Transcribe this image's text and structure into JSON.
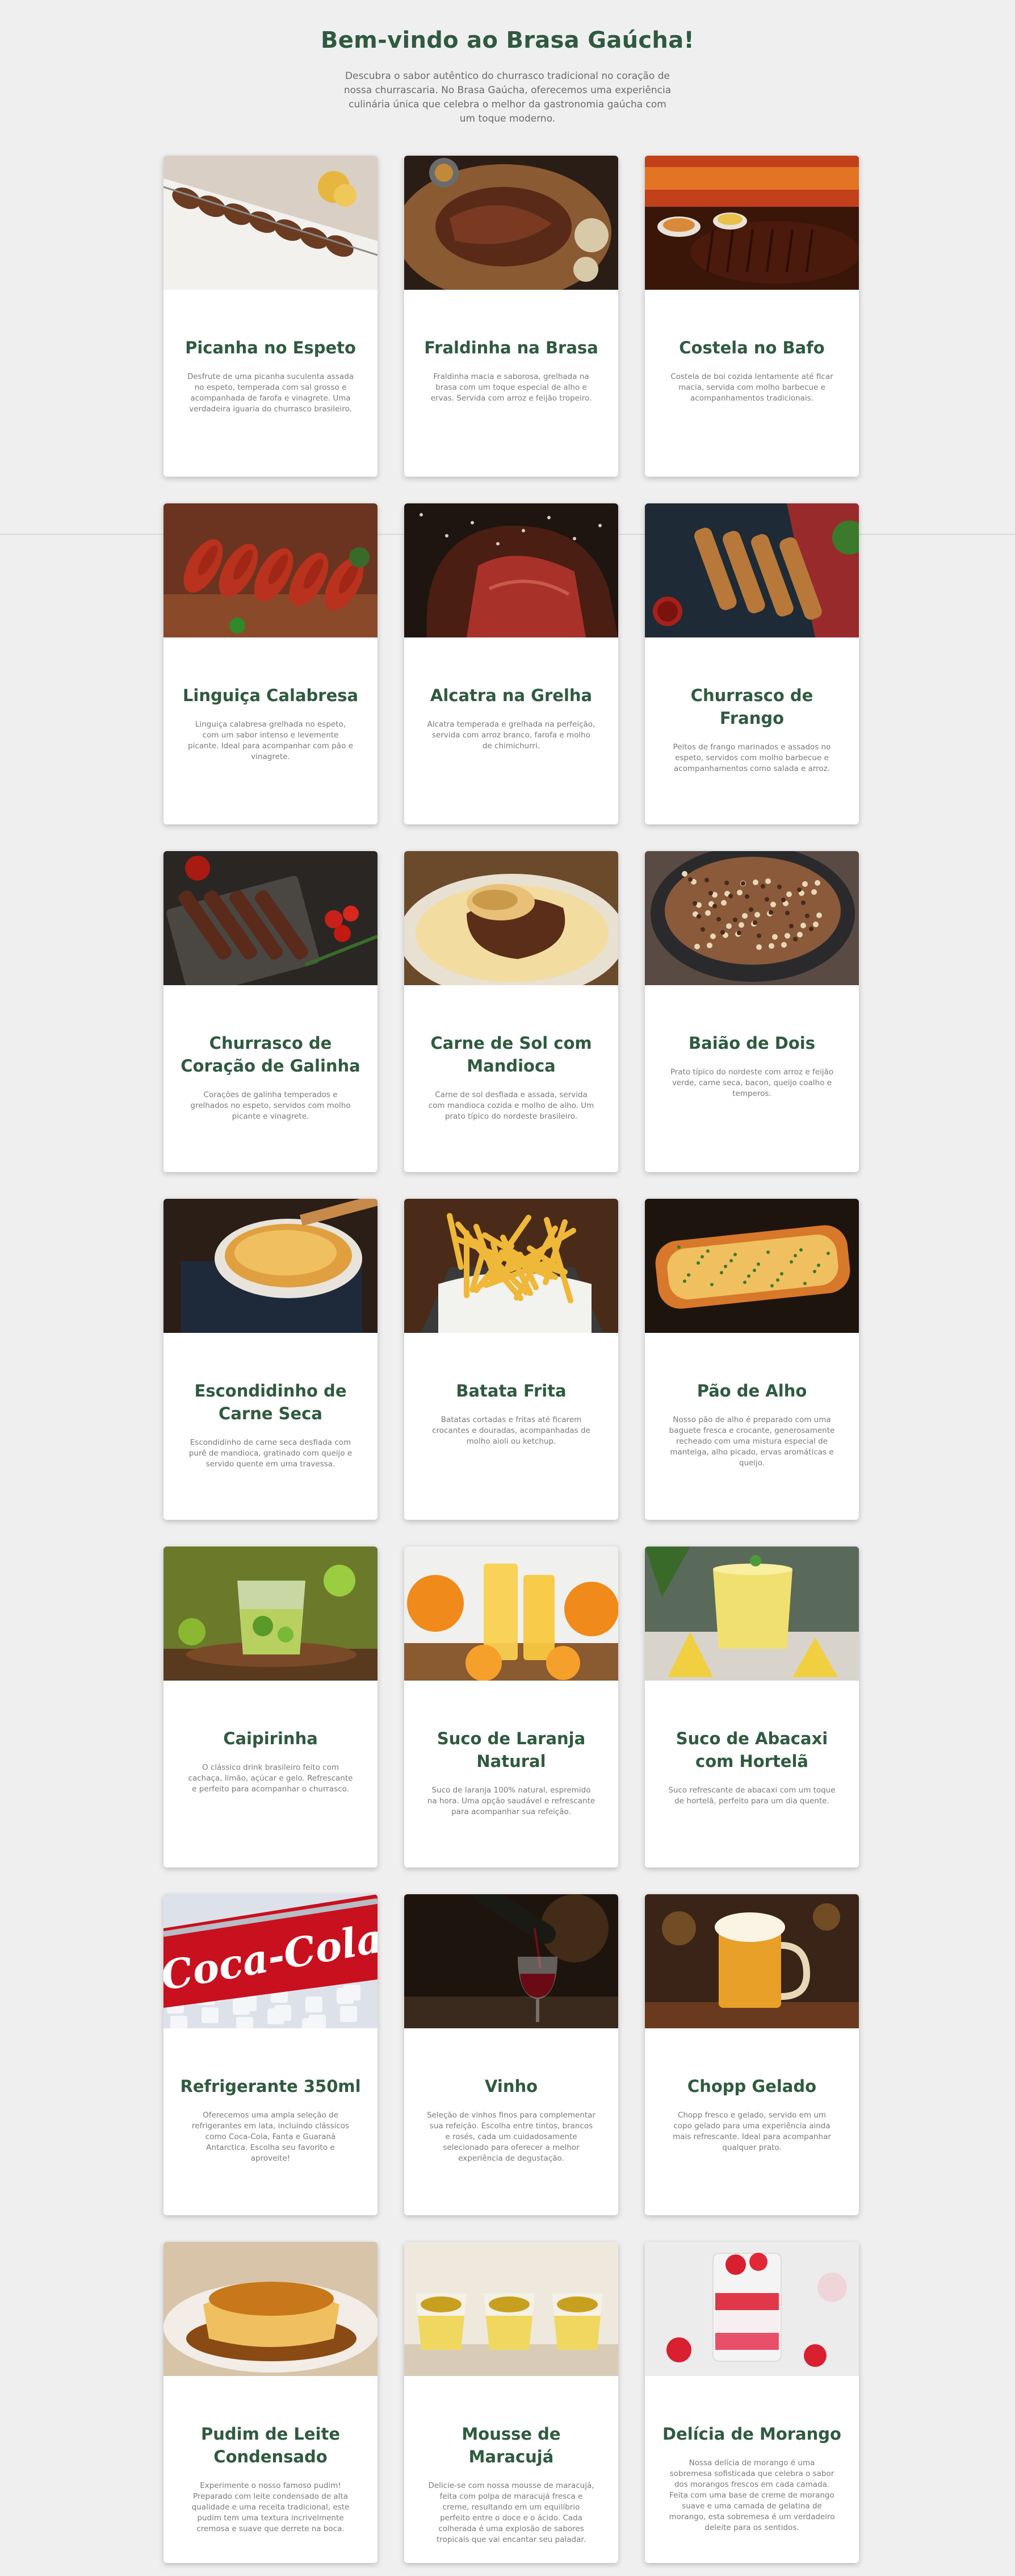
{
  "header": {
    "title": "Bem-vindo ao Brasa Gaúcha!",
    "intro": "Descubra o sabor autêntico do churrasco tradicional no coração de nossa churrascaria. No Brasa Gaúcha, oferecemos uma experiência culinária única que celebra o melhor da gastronomia gaúcha com um toque moderno."
  },
  "menu": [
    {
      "title": "Picanha no Espeto",
      "desc": "Desfrute de uma picanha suculenta assada no espeto, temperada com sal grosso e acompanhada de farofa e vinagrete. Uma verdadeira iguaria do churrasco brasileiro.",
      "icon": "picanha-photo"
    },
    {
      "title": "Fraldinha na Brasa",
      "desc": "Fraldinha macia e saborosa, grelhada na brasa com um toque especial de alho e ervas. Servida com arroz e feijão tropeiro.",
      "icon": "fraldinha-photo"
    },
    {
      "title": "Costela no Bafo",
      "desc": "Costela de boi cozida lentamente até ficar macia, servida com molho barbecue e acompanhamentos tradicionais.",
      "icon": "costela-photo"
    },
    {
      "title": "Linguiça Calabresa",
      "desc": "Linguiça calabresa grelhada no espeto, com um sabor intenso e levemente picante. Ideal para acompanhar com pão e vinagrete.",
      "icon": "linguica-photo"
    },
    {
      "title": "Alcatra na Grelha",
      "desc": "Alcatra temperada e grelhada na perfeição, servida com arroz branco, farofa e molho de chimichurri.",
      "icon": "alcatra-photo"
    },
    {
      "title": "Churrasco de Frango",
      "desc": "Peitos de frango marinados e assados no espeto, servidos com molho barbecue e acompanhamentos como salada e arroz.",
      "icon": "frango-photo"
    },
    {
      "title": "Churrasco de Coração de Galinha",
      "desc": "Corações de galinha temperados e grelhados no espeto, servidos com molho picante e vinagrete.",
      "icon": "coracao-photo"
    },
    {
      "title": "Carne de Sol com Mandioca",
      "desc": "Carne de sol desfiada e assada, servida com mandioca cozida e molho de alho. Um prato típico do nordeste brasileiro.",
      "icon": "carne-de-sol-photo"
    },
    {
      "title": "Baião de Dois",
      "desc": "Prato típico do nordeste com arroz e feijão verde, carne seca, bacon, queijo coalho e temperos.",
      "icon": "baiao-photo"
    },
    {
      "title": "Escondidinho de Carne Seca",
      "desc": "Escondidinho de carne seca desfiada com purê de mandioca, gratinado com queijo e servido quente em uma travessa.",
      "icon": "escondidinho-photo"
    },
    {
      "title": "Batata Frita",
      "desc": "Batatas cortadas e fritas até ficarem crocantes e douradas, acompanhadas de molho aioli ou ketchup.",
      "icon": "batata-photo"
    },
    {
      "title": "Pão de Alho",
      "desc": "Nosso pão de alho é preparado com uma baguete fresca e crocante, generosamente recheado com uma mistura especial de manteiga, alho picado, ervas aromáticas e queijo.",
      "icon": "pao-de-alho-photo"
    },
    {
      "title": "Caipirinha",
      "desc": "O clássico drink brasileiro feito com cachaça, limão, açúcar e gelo. Refrescante e perfeito para acompanhar o churrasco.",
      "icon": "caipirinha-photo"
    },
    {
      "title": "Suco de Laranja Natural",
      "desc": "Suco de laranja 100% natural, espremido na hora. Uma opção saudável e refrescante para acompanhar sua refeição.",
      "icon": "suco-laranja-photo"
    },
    {
      "title": "Suco de Abacaxi com Hortelã",
      "desc": "Suco refrescante de abacaxi com um toque de hortelã, perfeito para um dia quente.",
      "icon": "suco-abacaxi-photo"
    },
    {
      "title": "Refrigerante 350ml",
      "desc": "Oferecemos uma ampla seleção de refrigerantes em lata, incluindo clássicos como Coca-Cola, Fanta e Guaraná Antarctica. Escolha seu favorito e aproveite!",
      "icon": "refrigerante-photo",
      "photo_text": "Coca-Cola"
    },
    {
      "title": "Vinho",
      "desc": "Seleção de vinhos finos para complementar sua refeição. Escolha entre tintos, brancos e rosés, cada um cuidadosamente selecionado para oferecer a melhor experiência de degustação.",
      "icon": "vinho-photo"
    },
    {
      "title": "Chopp Gelado",
      "desc": "Chopp fresco e gelado, servido em um copo gelado para uma experiência ainda mais refrescante. Ideal para acompanhar qualquer prato.",
      "icon": "chopp-photo"
    },
    {
      "title": "Pudim de Leite Condensado",
      "desc": "Experimente o nosso famoso pudim! Preparado com leite condensado de alta qualidade e uma receita tradicional, este pudim tem uma textura incrivelmente cremosa e suave que derrete na boca.",
      "icon": "pudim-photo"
    },
    {
      "title": "Mousse de Maracujá",
      "desc": "Delicie-se com nossa mousse de maracujá, feita com polpa de maracujá fresca e creme, resultando em um equilíbrio perfeito entre o doce e o ácido. Cada colherada é uma explosão de sabores tropicais que vai encantar seu paladar.",
      "icon": "mousse-photo"
    },
    {
      "title": "Delícia de Morango",
      "desc": "Nossa delícia de morango é uma sobremesa sofisticada que celebra o sabor dos morangos frescos em cada camada. Feita com uma base de creme de morango suave e uma camada de gelatina de morango, esta sobremesa é um verdadeiro deleite para os sentidos.",
      "icon": "morango-photo"
    }
  ]
}
